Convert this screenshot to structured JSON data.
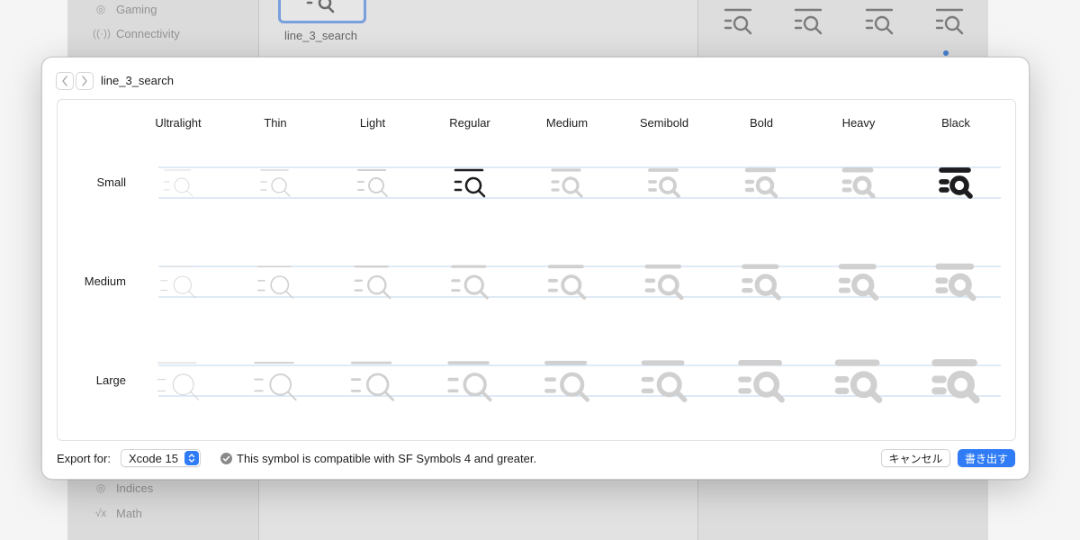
{
  "background": {
    "sidebar_items": [
      {
        "label": "Gaming",
        "icon": "gamecontroller-icon"
      },
      {
        "label": "Connectivity",
        "icon": "antenna-icon"
      },
      {
        "label": "Indices",
        "icon": "number-circle-icon"
      },
      {
        "label": "Math",
        "icon": "square-root-icon"
      }
    ],
    "selected_symbol_label": "line_3_search"
  },
  "sheet": {
    "title": "line_3_search",
    "back_icon": "chevron-left-icon",
    "forward_icon": "chevron-right-icon",
    "weights": [
      "Ultralight",
      "Thin",
      "Light",
      "Regular",
      "Medium",
      "Semibold",
      "Bold",
      "Heavy",
      "Black"
    ],
    "scales": [
      "Small",
      "Medium",
      "Large"
    ],
    "highlighted": [
      {
        "scale": "Small",
        "weight": "Regular"
      },
      {
        "scale": "Small",
        "weight": "Black"
      }
    ],
    "colors": {
      "active": "#1d1d1f",
      "inactive": "#d0d0d0",
      "guide": "#bcd6ee",
      "accent": "#2f7cf6"
    }
  },
  "footer": {
    "export_label": "Export for:",
    "export_value": "Xcode 15",
    "compat_message": "This symbol is compatible with SF Symbols 4 and greater.",
    "cancel_label": "キャンセル",
    "export_button_label": "書き出す"
  }
}
